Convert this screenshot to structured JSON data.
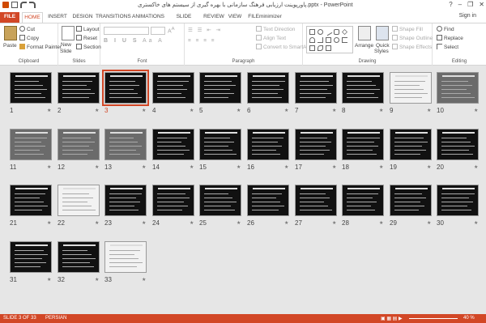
{
  "window": {
    "title": "پاورپوینت ارزیابی فرهنگ سازمانی با بهره گیری از سیستم های خاکستری.pptx - PowerPoint",
    "controls": [
      "?",
      "–",
      "❐",
      "✕"
    ]
  },
  "tabs": [
    "FILE",
    "HOME",
    "INSERT",
    "DESIGN",
    "TRANSITIONS",
    "ANIMATIONS",
    "SLIDE SHOW",
    "REVIEW",
    "VIEW",
    "FILEminimizer"
  ],
  "signin": "Sign in",
  "ribbon": {
    "clipboard": {
      "label": "Clipboard",
      "paste": "Paste",
      "cut": "Cut",
      "copy": "Copy",
      "format_painter": "Format Painter"
    },
    "slides": {
      "label": "Slides",
      "new_slide": "New",
      "new_slide_2": "Slide",
      "layout": "Layout",
      "reset": "Reset",
      "section": "Section"
    },
    "font": {
      "label": "Font"
    },
    "paragraph": {
      "label": "Paragraph",
      "text_direction": "Text Direction",
      "align_text": "Align Text",
      "convert": "Convert to SmartArt"
    },
    "drawing": {
      "label": "Drawing",
      "arrange": "Arrange",
      "quick_styles": "Quick",
      "quick_styles_2": "Styles",
      "shape_fill": "Shape Fill",
      "shape_outline": "Shape Outline",
      "shape_effects": "Shape Effects"
    },
    "editing": {
      "label": "Editing",
      "find": "Find",
      "replace": "Replace",
      "select": "Select"
    }
  },
  "slides": [
    {
      "n": "1"
    },
    {
      "n": "2"
    },
    {
      "n": "3"
    },
    {
      "n": "4"
    },
    {
      "n": "5"
    },
    {
      "n": "6"
    },
    {
      "n": "7"
    },
    {
      "n": "8"
    },
    {
      "n": "9"
    },
    {
      "n": "10"
    },
    {
      "n": "11"
    },
    {
      "n": "12"
    },
    {
      "n": "13"
    },
    {
      "n": "14"
    },
    {
      "n": "15"
    },
    {
      "n": "16"
    },
    {
      "n": "17"
    },
    {
      "n": "18"
    },
    {
      "n": "19"
    },
    {
      "n": "20"
    },
    {
      "n": "21"
    },
    {
      "n": "22"
    },
    {
      "n": "23"
    },
    {
      "n": "24"
    },
    {
      "n": "25"
    },
    {
      "n": "26"
    },
    {
      "n": "27"
    },
    {
      "n": "28"
    },
    {
      "n": "29"
    },
    {
      "n": "30"
    },
    {
      "n": "31"
    },
    {
      "n": "32"
    },
    {
      "n": "33"
    }
  ],
  "selected_slide": "3",
  "star": "★",
  "status": {
    "slide_info": "SLIDE 3 OF 33",
    "language": "PERSIAN",
    "zoom": "40 %"
  },
  "colors": {
    "accent": "#d24726"
  }
}
